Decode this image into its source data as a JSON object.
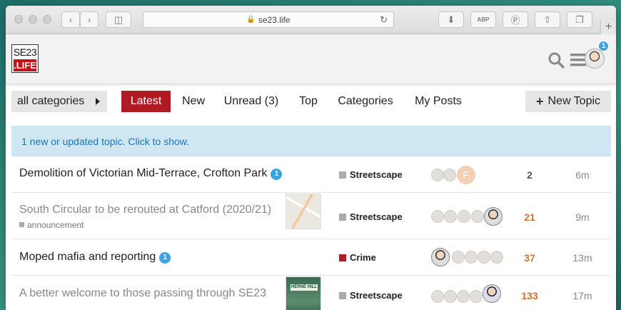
{
  "browser": {
    "address": "se23.life",
    "new_tab_icon": "plus-icon",
    "buttons": [
      "back-icon",
      "forward-icon",
      "sidebar-icon",
      "download-icon",
      "adblock-icon",
      "pinterest-icon",
      "share-icon",
      "tabs-icon"
    ],
    "abp_label": "ABP"
  },
  "site": {
    "logo_line1": "SE23",
    "logo_line2": ".LIFE",
    "notification_count": "1"
  },
  "nav": {
    "category_dropdown": "all categories",
    "tabs": [
      "Latest",
      "New",
      "Unread (3)",
      "Top",
      "Categories",
      "My Posts"
    ],
    "active_tab": "Latest",
    "new_topic": "New Topic"
  },
  "banner": "1 new or updated topic. Click to show.",
  "colors": {
    "accent": "#b01a22",
    "crime": "#b01a22",
    "streetscape": "#aaaaaa",
    "banner_bg": "#cfe7f3",
    "hot_count": "#d5702c"
  },
  "topics": [
    {
      "title": "Demolition of Victorian Mid-Terrace, Crofton Park",
      "new_badge": "1",
      "category": "Streetscape",
      "replies": "2",
      "activity": "6m"
    },
    {
      "title": "South Circular to be rerouted at Catford (2020/21)",
      "tag": "announcement",
      "category": "Streetscape",
      "replies": "21",
      "activity": "9m"
    },
    {
      "title": "Moped mafia and reporting",
      "new_badge": "1",
      "category": "Crime",
      "replies": "37",
      "activity": "13m"
    },
    {
      "title": "A better welcome to those passing through SE23",
      "category": "Streetscape",
      "replies": "133",
      "activity": "17m",
      "thumb_text": "HERNE HILL"
    }
  ],
  "poster_letter": "F"
}
